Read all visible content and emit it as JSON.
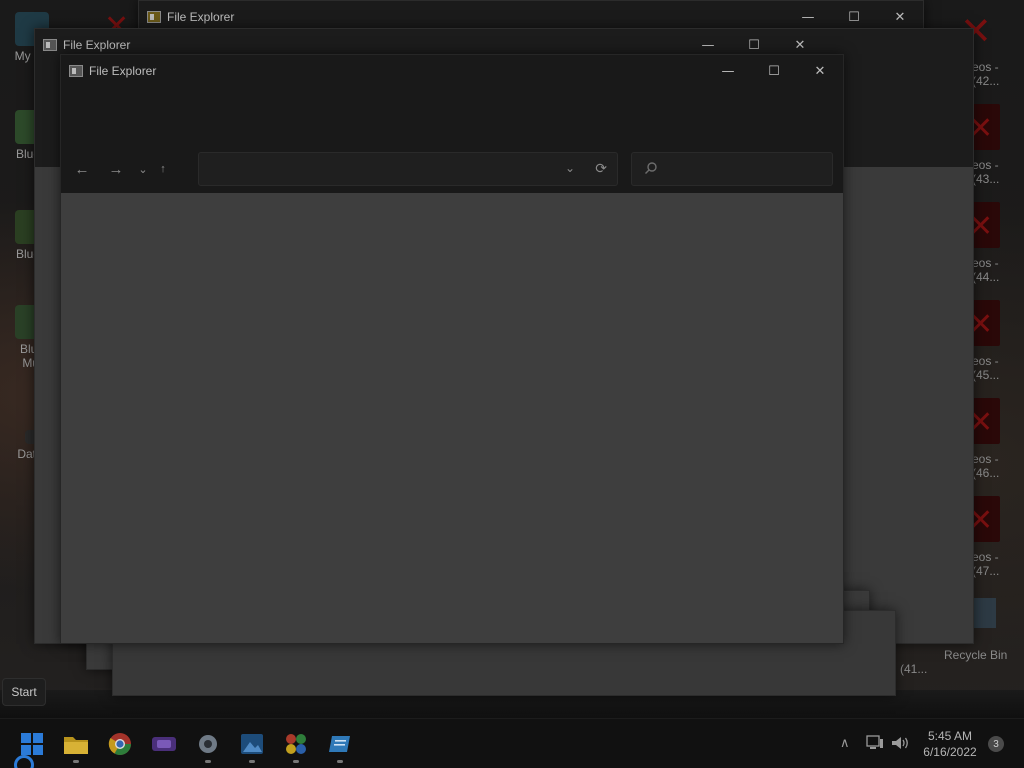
{
  "desktop": {
    "left_icons": [
      {
        "label": "My Co"
      },
      {
        "label": "BlueS"
      },
      {
        "label": "BlueS"
      },
      {
        "label": "Blue"
      },
      {
        "label": "Mul"
      },
      {
        "label": "Dater"
      }
    ],
    "right_labels": [
      {
        "line1": "eos -",
        "line2": "(42..."
      },
      {
        "line1": "eos -",
        "line2": "(43..."
      },
      {
        "line1": "eos -",
        "line2": "(44..."
      },
      {
        "line1": "eos -",
        "line2": "(45..."
      },
      {
        "line1": "eos -",
        "line2": "(46..."
      },
      {
        "line1": "eos -",
        "line2": "(47..."
      }
    ],
    "bottom_labels": {
      "partial": "(41...",
      "recycle_bin": "Recycle Bin"
    }
  },
  "windows": [
    {
      "title": "File Explorer"
    },
    {
      "title": "File Explorer"
    },
    {
      "title": "File Explorer"
    }
  ],
  "window_controls": {
    "minimize": "—",
    "maximize": "☐",
    "close": "✕"
  },
  "explorer": {
    "back": "←",
    "forward": "→",
    "recent": "⌄",
    "up": "↑",
    "address_value": "",
    "address_dropdown": "⌄",
    "refresh": "⟳",
    "search_placeholder": ""
  },
  "start_tooltip": "Start",
  "taskbar": {
    "apps": [
      "start-icon",
      "file-explorer-icon",
      "chrome-icon",
      "media-player-icon",
      "settings-icon",
      "photos-icon",
      "paint-icon",
      "notepad-icon"
    ],
    "tray": {
      "chevron": "∧",
      "time": "5:45 AM",
      "date": "6/16/2022",
      "notification_count": "3"
    }
  },
  "colors": {
    "accent": "#2b7bd8",
    "x_red": "#7a1010"
  }
}
